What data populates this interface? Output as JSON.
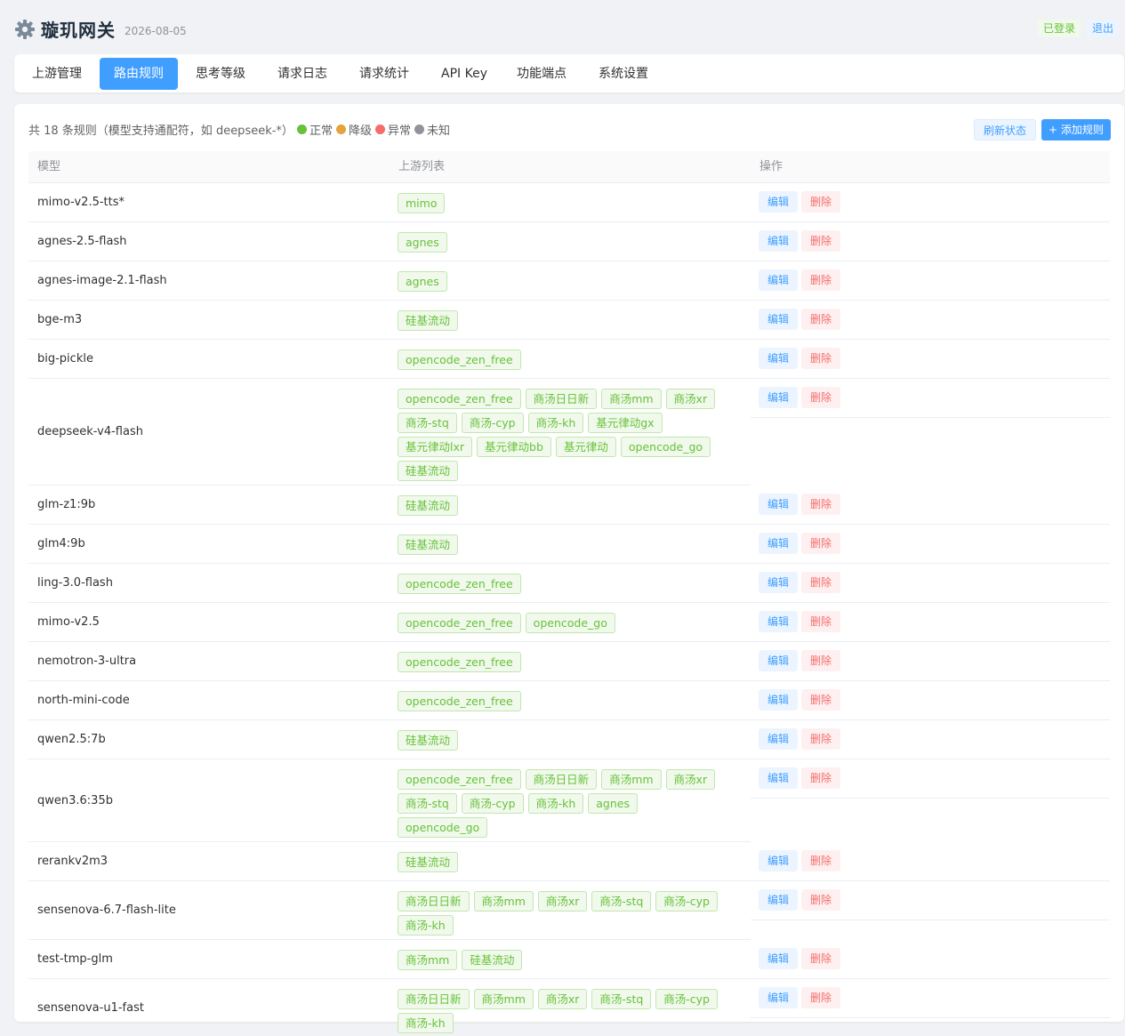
{
  "app": {
    "title": "璇玑网关",
    "date": "2026-08-05",
    "login_status": "已登录",
    "logout_label": "退出"
  },
  "tabs": [
    {
      "label": "上游管理"
    },
    {
      "label": "路由规则",
      "active": true
    },
    {
      "label": "思考等级"
    },
    {
      "label": "请求日志"
    },
    {
      "label": "请求统计"
    },
    {
      "label": "API Key"
    },
    {
      "label": "功能端点"
    },
    {
      "label": "系统设置"
    }
  ],
  "toolbar": {
    "summary": "共 18 条规则（模型支持通配符，如 deepseek-*）",
    "legend": [
      {
        "label": "正常",
        "color": "#67c23a"
      },
      {
        "label": "降级",
        "color": "#e6a23c"
      },
      {
        "label": "异常",
        "color": "#f56c6c"
      },
      {
        "label": "未知",
        "color": "#909399"
      }
    ],
    "refresh_label": "刷新状态",
    "add_label": "+ 添加规则"
  },
  "table": {
    "headers": {
      "model": "模型",
      "upstreams": "上游列表",
      "actions": "操作"
    },
    "edit_label": "编辑",
    "delete_label": "删除",
    "rows": [
      {
        "model": "mimo-v2.5-tts*",
        "upstreams": [
          "mimo"
        ]
      },
      {
        "model": "agnes-2.5-flash",
        "upstreams": [
          "agnes"
        ]
      },
      {
        "model": "agnes-image-2.1-flash",
        "upstreams": [
          "agnes"
        ]
      },
      {
        "model": "bge-m3",
        "upstreams": [
          "硅基流动"
        ]
      },
      {
        "model": "big-pickle",
        "upstreams": [
          "opencode_zen_free"
        ]
      },
      {
        "model": "deepseek-v4-flash",
        "upstreams": [
          "opencode_zen_free",
          "商汤日日新",
          "商汤mm",
          "商汤xr",
          "商汤-stq",
          "商汤-cyp",
          "商汤-kh",
          "基元律动gx",
          "基元律动lxr",
          "基元律动bb",
          "基元律动",
          "opencode_go",
          "硅基流动"
        ]
      },
      {
        "model": "glm-z1:9b",
        "upstreams": [
          "硅基流动"
        ]
      },
      {
        "model": "glm4:9b",
        "upstreams": [
          "硅基流动"
        ]
      },
      {
        "model": "ling-3.0-flash",
        "upstreams": [
          "opencode_zen_free"
        ]
      },
      {
        "model": "mimo-v2.5",
        "upstreams": [
          "opencode_zen_free",
          "opencode_go"
        ]
      },
      {
        "model": "nemotron-3-ultra",
        "upstreams": [
          "opencode_zen_free"
        ]
      },
      {
        "model": "north-mini-code",
        "upstreams": [
          "opencode_zen_free"
        ]
      },
      {
        "model": "qwen2.5:7b",
        "upstreams": [
          "硅基流动"
        ]
      },
      {
        "model": "qwen3.6:35b",
        "upstreams": [
          "opencode_zen_free",
          "商汤日日新",
          "商汤mm",
          "商汤xr",
          "商汤-stq",
          "商汤-cyp",
          "商汤-kh",
          "agnes",
          "opencode_go"
        ]
      },
      {
        "model": "rerankv2m3",
        "upstreams": [
          "硅基流动"
        ]
      },
      {
        "model": "sensenova-6.7-flash-lite",
        "upstreams": [
          "商汤日日新",
          "商汤mm",
          "商汤xr",
          "商汤-stq",
          "商汤-cyp",
          "商汤-kh"
        ]
      },
      {
        "model": "test-tmp-glm",
        "upstreams": [
          "商汤mm",
          "硅基流动"
        ]
      },
      {
        "model": "sensenova-u1-fast",
        "upstreams": [
          "商汤日日新",
          "商汤mm",
          "商汤xr",
          "商汤-stq",
          "商汤-cyp",
          "商汤-kh"
        ]
      }
    ]
  }
}
